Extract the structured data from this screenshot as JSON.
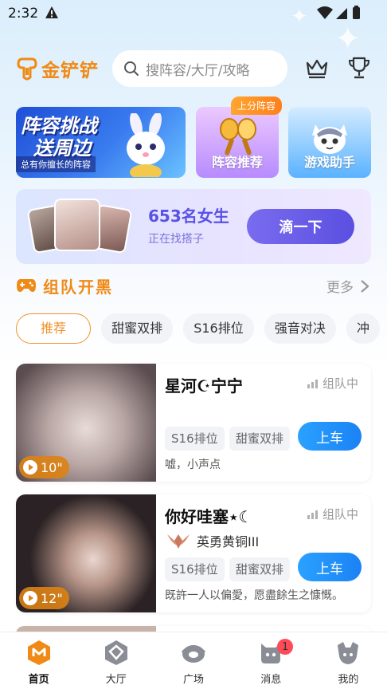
{
  "status_bar": {
    "time": "2:32"
  },
  "header": {
    "logo_text": "金铲铲",
    "search_placeholder": "搜阵容/大厅/攻略"
  },
  "banners": {
    "main": {
      "line1": "阵容挑战",
      "line2": "送周边",
      "caption": "总有你擅长的阵容"
    },
    "tile1": {
      "label": "阵容推荐",
      "badge": "上分阵容"
    },
    "tile2": {
      "label": "游戏助手"
    }
  },
  "match": {
    "count_text": "653名女生",
    "sub_text": "正在找搭子",
    "button_label": "滴一下"
  },
  "section": {
    "title": "组队开黑",
    "more_label": "更多"
  },
  "chips": [
    "推荐",
    "甜蜜双排",
    "S16排位",
    "强音对决",
    "冲"
  ],
  "cards": [
    {
      "name": "星河☪宁宁",
      "state": "组队中",
      "duration": "10\"",
      "tags": [
        "S16排位",
        "甜蜜双排"
      ],
      "button": "上车",
      "desc": "嘘，小声点"
    },
    {
      "name": "你好哇塞⋆☾",
      "state": "组队中",
      "rank": "英勇黄铜III",
      "duration": "12\"",
      "tags": [
        "S16排位",
        "甜蜜双排"
      ],
      "button": "上车",
      "desc": "既許一人以偏愛，愿盡餘生之慷慨。"
    }
  ],
  "nav": [
    {
      "label": "首页",
      "icon": "home-icon",
      "active": true
    },
    {
      "label": "大厅",
      "icon": "hall-icon"
    },
    {
      "label": "广场",
      "icon": "plaza-icon"
    },
    {
      "label": "消息",
      "icon": "message-icon",
      "badge": "1"
    },
    {
      "label": "我的",
      "icon": "profile-icon"
    }
  ],
  "colors": {
    "brand_orange": "#f08a16",
    "match_purple": "#5a52e6",
    "go_blue": "#1b82f5",
    "badge_red": "#ff4a5a"
  }
}
